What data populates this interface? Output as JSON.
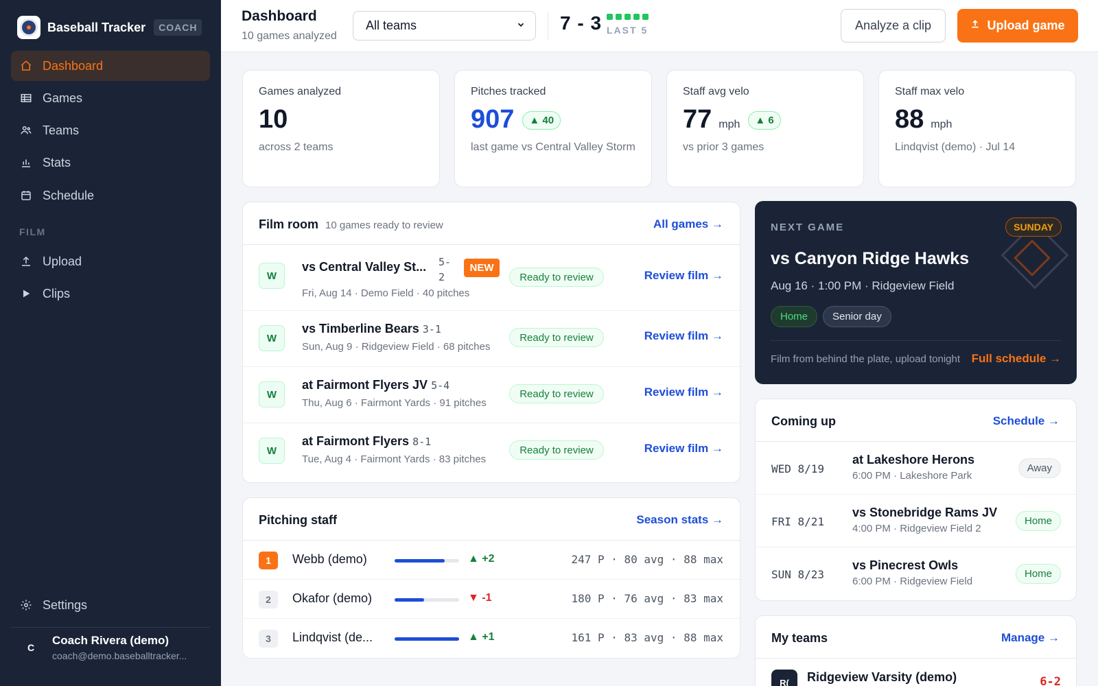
{
  "app": {
    "name": "Baseball Tracker",
    "badge": "COACH"
  },
  "sidebar": {
    "items": [
      {
        "label": "Dashboard",
        "icon": "home-icon",
        "active": true
      },
      {
        "label": "Games",
        "icon": "table-icon"
      },
      {
        "label": "Teams",
        "icon": "users-icon"
      },
      {
        "label": "Stats",
        "icon": "bar-chart-icon"
      },
      {
        "label": "Schedule",
        "icon": "calendar-icon"
      }
    ],
    "film_section": "FILM",
    "film_items": [
      {
        "label": "Upload",
        "icon": "upload-icon"
      },
      {
        "label": "Clips",
        "icon": "play-icon"
      }
    ],
    "settings": {
      "label": "Settings",
      "icon": "gear-icon"
    },
    "user": {
      "initial": "C",
      "name": "Coach Rivera (demo)",
      "email": "coach@demo.baseballtracker..."
    }
  },
  "header": {
    "title": "Dashboard",
    "subtitle": "10 games analyzed",
    "team_select": "All teams",
    "record": "7 - 3",
    "last_label": "LAST 5",
    "last_results": [
      "W",
      "W",
      "W",
      "W",
      "W"
    ],
    "analyze_label": "Analyze a clip",
    "upload_label": "Upload game"
  },
  "stats": [
    {
      "label": "Games analyzed",
      "value": "10",
      "unit": "",
      "delta": "",
      "note": "across 2 teams"
    },
    {
      "label": "Pitches tracked",
      "value": "907",
      "unit": "",
      "delta": "▲ 40",
      "note": "last game vs Central Valley Storm"
    },
    {
      "label": "Staff avg velo",
      "value": "77",
      "unit": "mph",
      "delta": "▲ 6",
      "note": "vs prior 3 games"
    },
    {
      "label": "Staff max velo",
      "value": "88",
      "unit": "mph",
      "delta": "",
      "note": "Lindqvist (demo) · Jul 14"
    }
  ],
  "film_room": {
    "title": "Film room",
    "subtitle": "10 games ready to review",
    "link": "All games →",
    "ready_label": "Ready to review",
    "review_label": "Review film →",
    "new_label": "NEW",
    "rows": [
      {
        "result": "W",
        "opponent": "vs Central Valley St...",
        "score_a": "5-",
        "score_b": "2",
        "meta": "Fri, Aug 14 · Demo Field · 40 pitches"
      },
      {
        "result": "W",
        "opponent": "vs Timberline Bears",
        "score": "3-1",
        "meta": "Sun, Aug 9 · Ridgeview Field · 68 pitches"
      },
      {
        "result": "W",
        "opponent": "at Fairmont Flyers JV",
        "score": "5-4",
        "meta": "Thu, Aug 6 · Fairmont Yards · 91 pitches"
      },
      {
        "result": "W",
        "opponent": "at Fairmont Flyers",
        "score": "8-1",
        "meta": "Tue, Aug 4 · Fairmont Yards · 83 pitches"
      }
    ]
  },
  "pitching": {
    "title": "Pitching staff",
    "link": "Season stats →",
    "rows": [
      {
        "rank": "1",
        "name": "Webb (demo)",
        "bar": 0.78,
        "trend": "▲ +2",
        "dir": "up",
        "stats": "247 P · 80 avg · 88 max"
      },
      {
        "rank": "2",
        "name": "Okafor (demo)",
        "bar": 0.46,
        "trend": "▼ -1",
        "dir": "down",
        "stats": "180 P · 76 avg · 83 max"
      },
      {
        "rank": "3",
        "name": "Lindqvist (de...",
        "bar": 1.0,
        "trend": "▲ +1",
        "dir": "up",
        "stats": "161 P · 83 avg · 88 max"
      }
    ]
  },
  "next_game": {
    "label": "NEXT GAME",
    "day": "SUNDAY",
    "title": "vs Canyon Ridge Hawks",
    "when": "Aug 16 · 1:00 PM · Ridgeview Field",
    "tags": [
      "Home",
      "Senior day"
    ],
    "footnote": "Film from behind the plate, upload tonight",
    "link": "Full schedule →"
  },
  "coming_up": {
    "title": "Coming up",
    "link": "Schedule →",
    "rows": [
      {
        "date": "WED 8/19",
        "title": "at Lakeshore Herons",
        "meta": "6:00 PM · Lakeshore Park",
        "tag": "Away"
      },
      {
        "date": "FRI 8/21",
        "title": "vs Stonebridge Rams JV",
        "meta": "4:00 PM · Ridgeview Field 2",
        "tag": "Home"
      },
      {
        "date": "SUN 8/23",
        "title": "vs Pinecrest Owls",
        "meta": "6:00 PM · Ridgeview Field",
        "tag": "Home"
      }
    ]
  },
  "my_teams": {
    "title": "My teams",
    "link": "Manage →",
    "teams": [
      {
        "initials": "R(",
        "name": "Ridgeview Varsity (demo)",
        "record": "6-2"
      }
    ]
  },
  "colors": {
    "accent": "#f97316",
    "sidebar_bg": "#1b2436",
    "link": "#1d4ed8",
    "win": "#22c55e"
  }
}
